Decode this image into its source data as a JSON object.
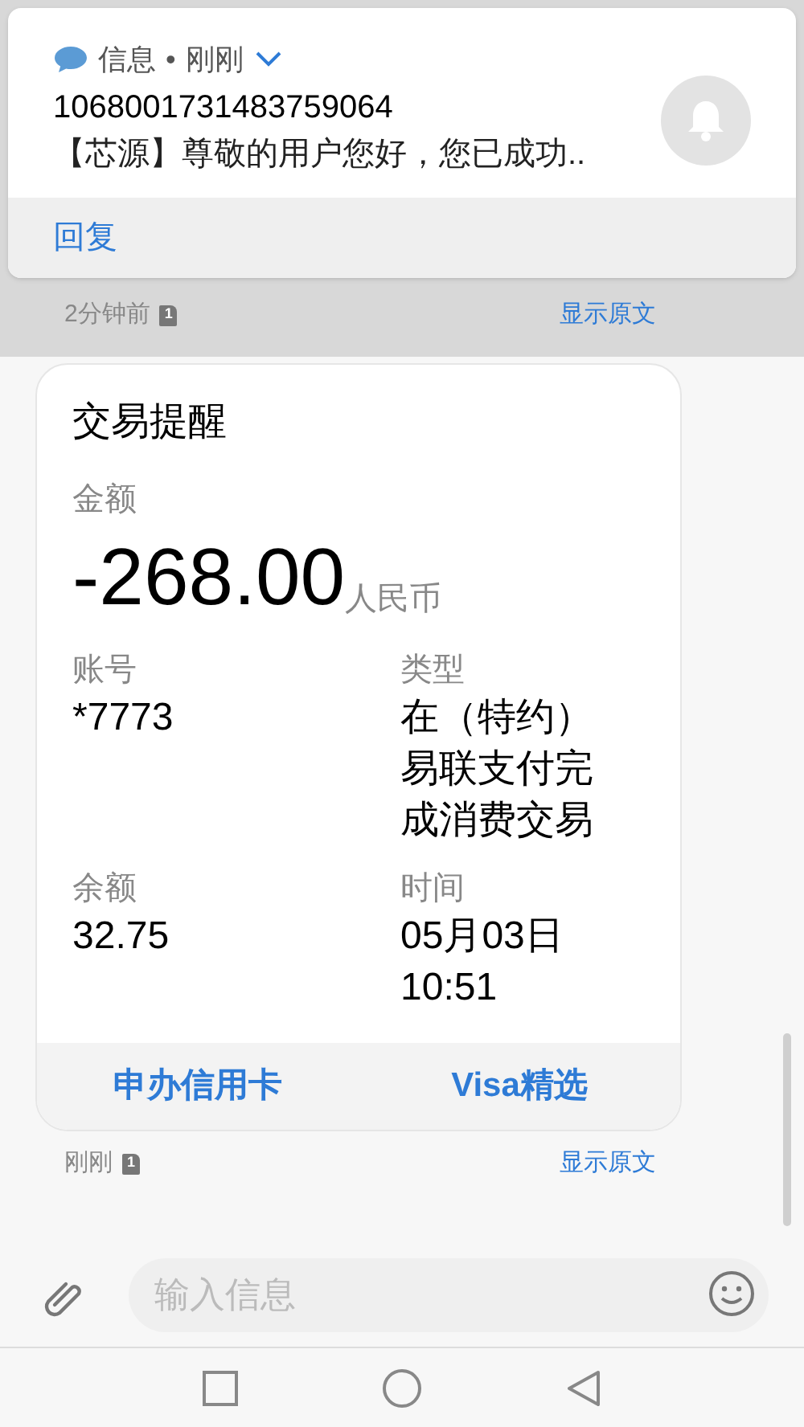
{
  "notification": {
    "app": "信息",
    "separator": "•",
    "time": "刚刚",
    "sender": "1068001731483759064",
    "preview": "【芯源】尊敬的用户您好，您已成功..",
    "action": "回复"
  },
  "previous_message": {
    "time": "2分钟前",
    "sim": "1",
    "link": "显示原文"
  },
  "card": {
    "title": "交易提醒",
    "amount_label": "金额",
    "amount": "-268.00",
    "currency": "人民币",
    "fields": [
      {
        "label": "账号",
        "value": "*7773"
      },
      {
        "label": "类型",
        "value": "在（特约）易联支付完成消费交易"
      },
      {
        "label": "余额",
        "value": "32.75"
      },
      {
        "label": "时间",
        "value": "05月03日 10:51"
      }
    ],
    "actions": [
      "申办信用卡",
      "Visa精选"
    ]
  },
  "message_meta": {
    "time": "刚刚",
    "sim": "1",
    "link": "显示原文"
  },
  "composer": {
    "placeholder": "输入信息"
  }
}
